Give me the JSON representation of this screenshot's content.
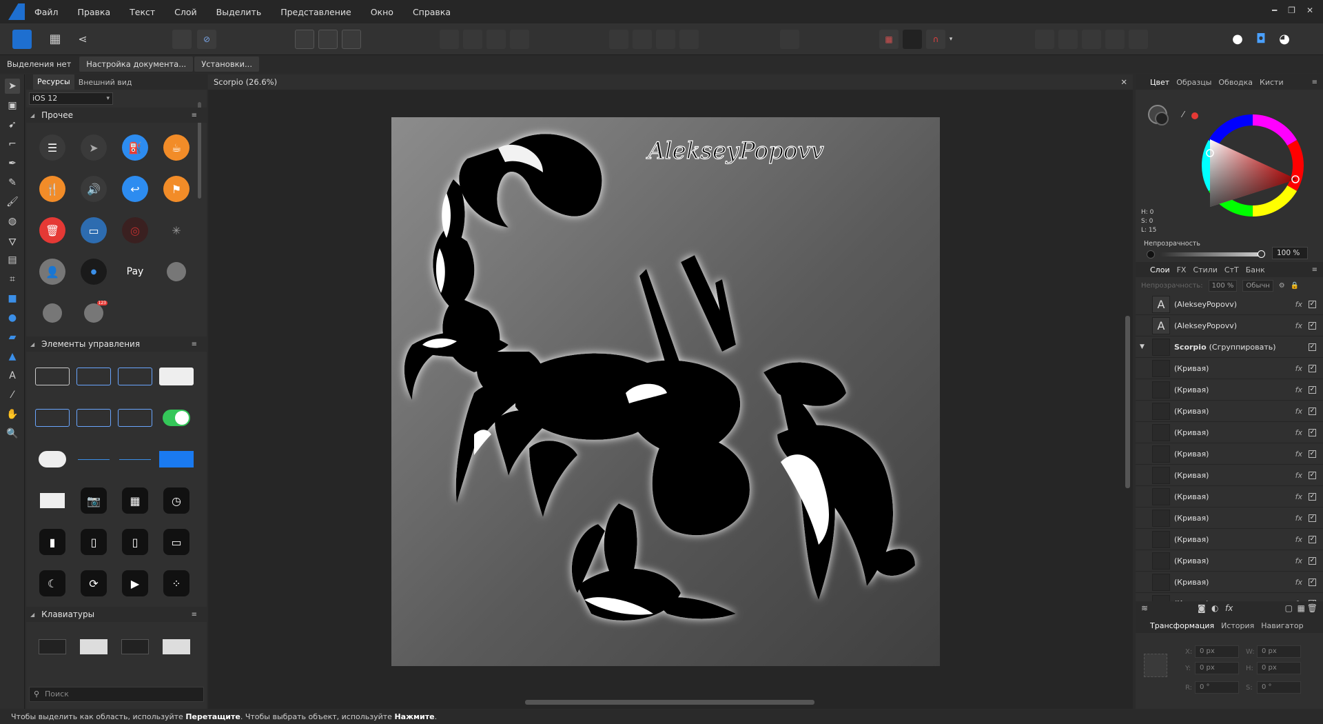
{
  "menu": [
    "Файл",
    "Правка",
    "Текст",
    "Слой",
    "Выделить",
    "Представление",
    "Окно",
    "Справка"
  ],
  "context": {
    "selection": "Выделения нет",
    "doc_setup": "Настройка документа...",
    "prefs": "Установки..."
  },
  "left_panel": {
    "tabs": [
      "Ресурсы",
      "Внешний вид"
    ],
    "dropdown": "iOS 12",
    "sections": [
      "Прочее",
      "Элементы управления",
      "Клавиатуры"
    ],
    "misc_texts": {
      "apple_pay": "Pay",
      "badge": "123"
    },
    "search_placeholder": "Поиск"
  },
  "document": {
    "tab_title": "Scorpio (26.6%)",
    "artwork_text": "AlekseyPopovv"
  },
  "right_panel": {
    "tabs": [
      "Цвет",
      "Образцы",
      "Обводка",
      "Кисти"
    ],
    "hsl": {
      "h": "H: 0",
      "s": "S: 0",
      "l": "L: 15"
    },
    "opacity_label": "Непрозрачность",
    "opacity_value": "100 %",
    "layer_tabs": [
      "Слои",
      "FX",
      "Стили",
      "СтТ",
      "Банк"
    ],
    "layer_opacity_label": "Непрозрачность:",
    "layer_opacity": "100 %",
    "blend_mode": "Обычн",
    "layers": [
      {
        "name": "(AlekseyPopovv)",
        "kind": "text"
      },
      {
        "name": "(AlekseyPopovv)",
        "kind": "text"
      },
      {
        "name": "Scorpio",
        "suffix": "(Сгруппировать)",
        "kind": "group"
      },
      {
        "name": "(Кривая)",
        "kind": "curve"
      },
      {
        "name": "(Кривая)",
        "kind": "curve"
      },
      {
        "name": "(Кривая)",
        "kind": "curve"
      },
      {
        "name": "(Кривая)",
        "kind": "curve"
      },
      {
        "name": "(Кривая)",
        "kind": "curve"
      },
      {
        "name": "(Кривая)",
        "kind": "curve"
      },
      {
        "name": "(Кривая)",
        "kind": "curve"
      },
      {
        "name": "(Кривая)",
        "kind": "curve"
      },
      {
        "name": "(Кривая)",
        "kind": "curve"
      },
      {
        "name": "(Кривая)",
        "kind": "curve"
      },
      {
        "name": "(Кривая)",
        "kind": "curve"
      },
      {
        "name": "(Кривая)",
        "kind": "curve"
      }
    ],
    "bottom_tabs": [
      "Трансформация",
      "История",
      "Навигатор"
    ],
    "transform": {
      "x": "0 px",
      "y": "0 px",
      "w": "0 px",
      "h": "0 px",
      "r": "0 °",
      "s": "0 °"
    }
  },
  "status": {
    "part1": "Чтобы выделить как область, используйте ",
    "drag": "Перетащите",
    "part2": ". Чтобы выбрать объект, используйте ",
    "click": "Нажмите",
    "part3": "."
  },
  "colors": {
    "accent": "#1e6fd0",
    "orange": "#f28c28",
    "blue": "#2d8cf0",
    "red": "#e53935",
    "green": "#34c759"
  }
}
